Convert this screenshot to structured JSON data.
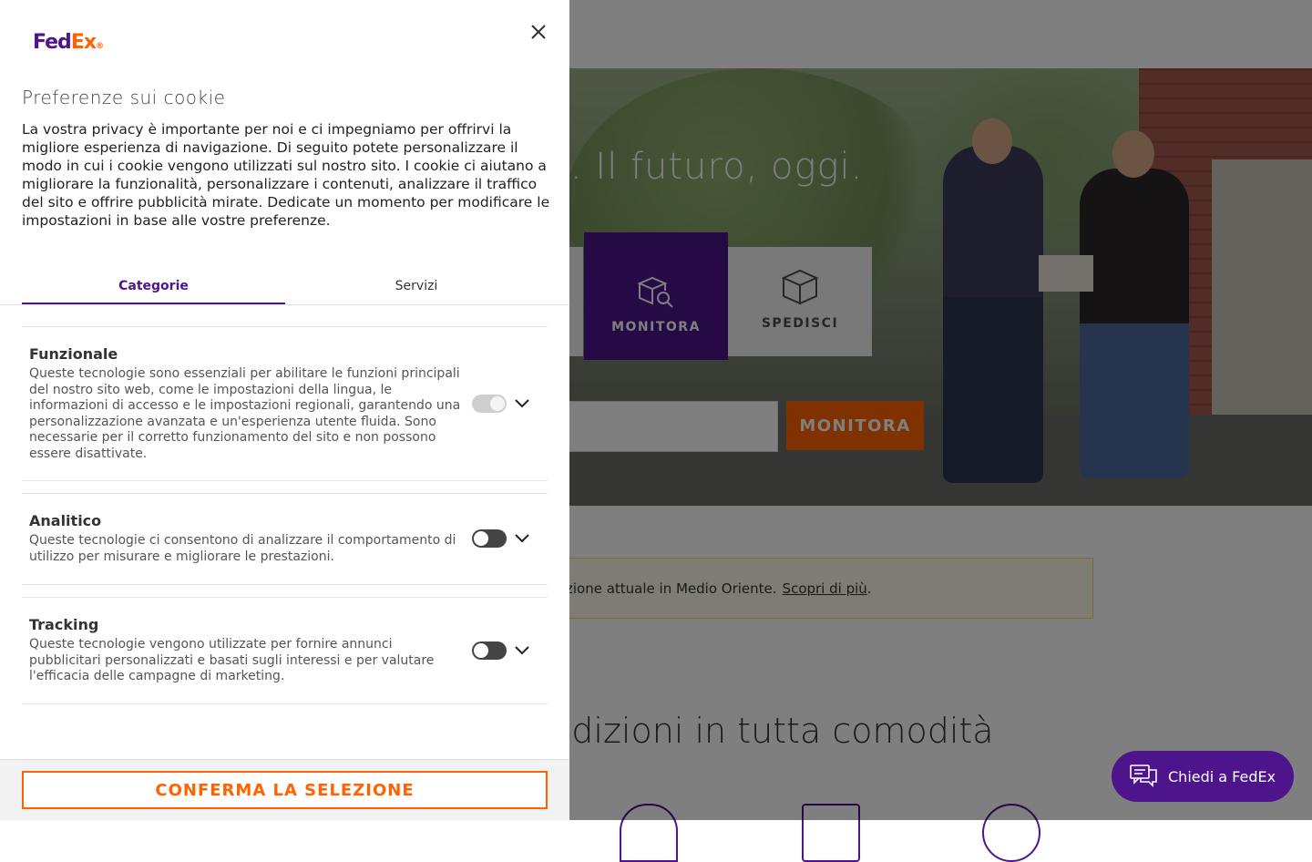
{
  "cookie_panel": {
    "logo": {
      "fed": "Fed",
      "ex": "Ex",
      "suffix": "®"
    },
    "title": "Preferenze sui cookie",
    "description": "La vostra privacy è importante per noi e ci impegniamo per offrirvi la migliore esperienza di navigazione. Di seguito potete personalizzare il modo in cui i cookie vengono utilizzati sul nostro sito. I cookie ci aiutano a migliorare la funzionalità, personalizzare i contenuti, analizzare il traffico del sito e offrire pubblicità mirate. Dedicate un momento per modificare le impostazioni in base alle vostre preferenze.",
    "tabs": [
      {
        "label": "Categorie",
        "active": true
      },
      {
        "label": "Servizi",
        "active": false
      }
    ],
    "categories": [
      {
        "title": "Funzionale",
        "description": "Queste tecnologie sono essenziali per abilitare le funzioni principali del nostro sito web, come le impostazioni della lingua, le informazioni di accesso e le impostazioni regionali, garantendo una personalizzazione avanzata e un'esperienza utente fluida. Sono necessarie per il corretto funzionamento del sito e non possono essere disattivate.",
        "enabled": true,
        "locked": true
      },
      {
        "title": "Analitico",
        "description": "Queste tecnologie ci consentono di analizzare il comportamento di utilizzo per misurare e migliorare le prestazioni.",
        "enabled": false,
        "locked": false
      },
      {
        "title": "Tracking",
        "description": "Queste tecnologie vengono utilizzate per fornire annunci pubblicitari personalizzati e basati sugli interessi e per valutare l'efficacia delle campagne di marketing.",
        "enabled": false,
        "locked": false
      }
    ],
    "confirm_label": "CONFERMA LA SELEZIONE"
  },
  "background": {
    "hero_title": ". Il futuro, oggi.",
    "tiles": [
      {
        "label": "MONITORA"
      },
      {
        "label": "SPEDISCI"
      }
    ],
    "track_button": "MONITORA",
    "alert_text": "zione attuale in Medio Oriente.",
    "alert_link": "Scopri di più",
    "alert_end": ".",
    "section_title": "spedizioni in tutta comodità"
  },
  "chat": {
    "label": "Chiedi a FedEx"
  },
  "colors": {
    "purple": "#4d148c",
    "orange": "#ff6200",
    "overlay": "rgba(0,0,0,0.5)"
  },
  "icons": [
    "close-icon",
    "chevron-down-icon",
    "package-search-icon",
    "package-icon",
    "chat-icon"
  ]
}
